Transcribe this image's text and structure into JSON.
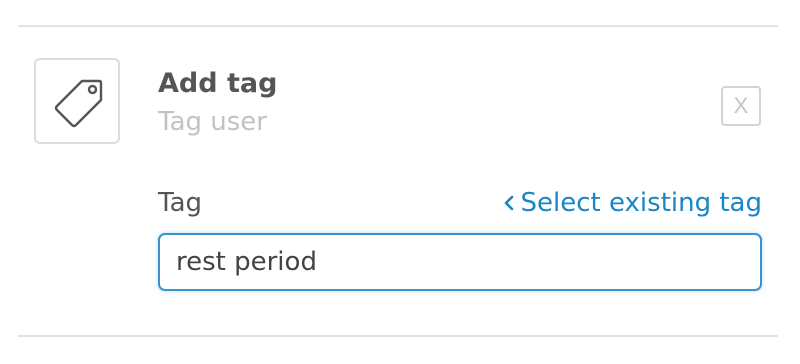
{
  "header": {
    "title": "Add tag",
    "subtitle": "Tag user",
    "icon": "tag-icon",
    "close_label": "X"
  },
  "field": {
    "label": "Tag",
    "link_label": "Select existing tag",
    "link_icon": "chevron-left-icon",
    "value": "rest period"
  },
  "colors": {
    "accent": "#1a86c6",
    "input_border": "#3a93cf",
    "title": "#555555",
    "muted": "#c2c2c2",
    "divider": "#e3e3e3"
  }
}
